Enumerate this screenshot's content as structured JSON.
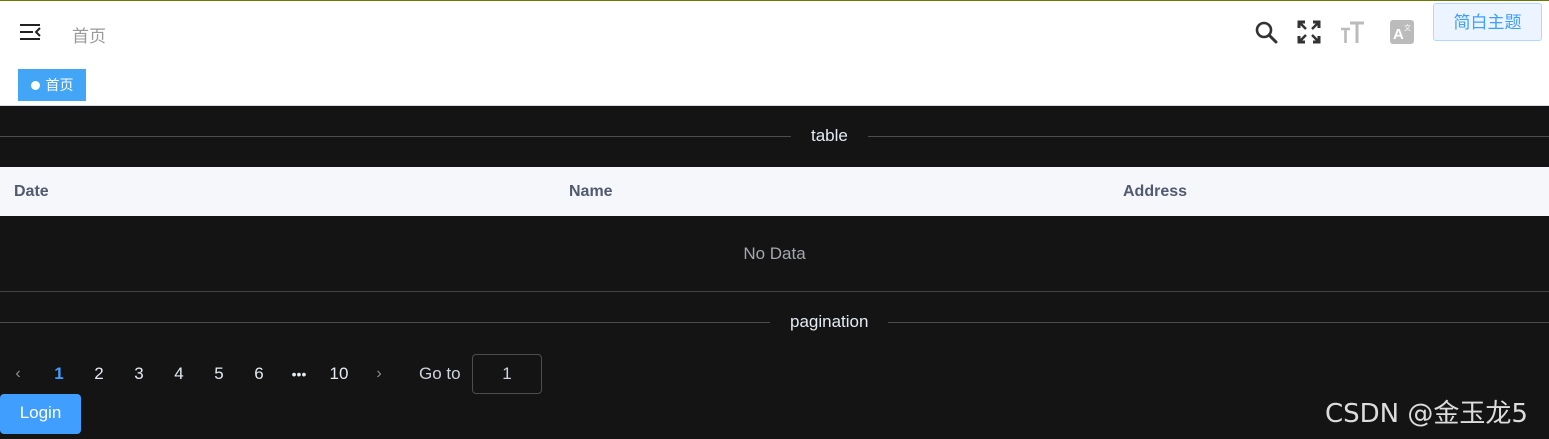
{
  "navbar": {
    "breadcrumb": "首页",
    "theme_button_label": "简白主题",
    "icons": [
      "menu-fold-icon",
      "search-icon",
      "fullscreen-icon",
      "font-size-icon",
      "language-icon"
    ]
  },
  "tags": {
    "active_tag": "首页"
  },
  "table_section": {
    "divider_title": "table",
    "columns": [
      "Date",
      "Name",
      "Address"
    ],
    "empty_text": "No Data"
  },
  "pagination_section": {
    "divider_title": "pagination",
    "pages": [
      "1",
      "2",
      "3",
      "4",
      "5",
      "6",
      "10"
    ],
    "current_page": "1",
    "more": "•••",
    "goto_label": "Go to",
    "goto_value": "1"
  },
  "login_button_label": "Login",
  "watermark": "CSDN @金玉龙5",
  "colors": {
    "accent": "#409eff",
    "tag_active": "#42a5f5",
    "content_bg": "#141414",
    "table_header_bg": "#f5f7fa"
  }
}
